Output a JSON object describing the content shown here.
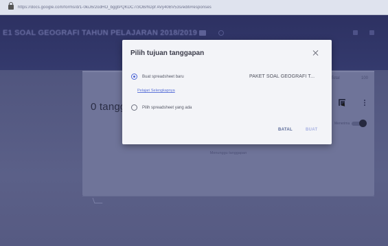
{
  "browser": {
    "url": "https://docs.google.com/forms/d/1-0kiJ6/2odHO_bggtPQKDC7/3OB/hDpf AVy40BV53s/edit#responses"
  },
  "header": {
    "form_title": "E1 SOAL GEOGRAFI TAHUN PELAJARAN 2018/2019"
  },
  "responses": {
    "count_text": "0 tanggapan",
    "total_label": "Total",
    "total_value": "100",
    "accepting_label": "Menerima",
    "waiting_text": "Menunggu tanggapan"
  },
  "dialog": {
    "title": "Pilih tujuan tanggapan",
    "option_new_label": "Buat spreadsheet baru",
    "spreadsheet_name": "PAKET SOAL GEOGRAFI T...",
    "learn_more": "Pelajari Selengkapnya",
    "option_existing_label": "Pilih spreadsheet yang ada",
    "cancel_label": "BATAL",
    "create_label": "BUAT"
  },
  "colors": {
    "accent": "#4a63d6",
    "header_bg": "#2d3162",
    "dialog_bg": "#f3f4f8"
  }
}
